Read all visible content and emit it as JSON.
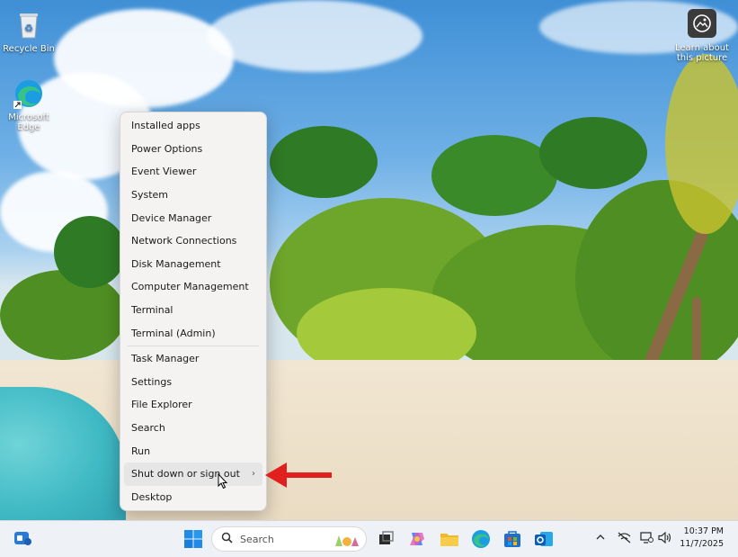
{
  "desktop": {
    "icons": [
      {
        "label": "Recycle Bin",
        "icon": "recycle-bin-icon"
      },
      {
        "label": "Microsoft Edge",
        "icon": "edge-icon"
      }
    ],
    "learn_about": "Learn about this picture"
  },
  "context_menu": {
    "items": [
      "Installed apps",
      "Power Options",
      "Event Viewer",
      "System",
      "Device Manager",
      "Network Connections",
      "Disk Management",
      "Computer Management",
      "Terminal",
      "Terminal (Admin)",
      "Task Manager",
      "Settings",
      "File Explorer",
      "Search",
      "Run",
      "Shut down or sign out",
      "Desktop"
    ],
    "highlighted": "Shut down or sign out",
    "submenu_indicator": "›"
  },
  "annotation": {
    "color": "#e01f1f",
    "shape": "left-arrow"
  },
  "taskbar": {
    "search_placeholder": "Search",
    "pinned": [
      "start-icon",
      "search-icon",
      "task-view-icon",
      "copilot-icon",
      "file-explorer-icon",
      "edge-icon",
      "store-icon",
      "outlook-icon"
    ],
    "tray": [
      "chevron-up-icon",
      "network-off-icon",
      "display-icon",
      "volume-icon"
    ],
    "time": "10:37 PM",
    "date": "11/7/2025"
  },
  "colors": {
    "accent": "#0067c0",
    "menu_bg": "#f4f3f2",
    "taskbar_bg": "#eef1f5"
  }
}
